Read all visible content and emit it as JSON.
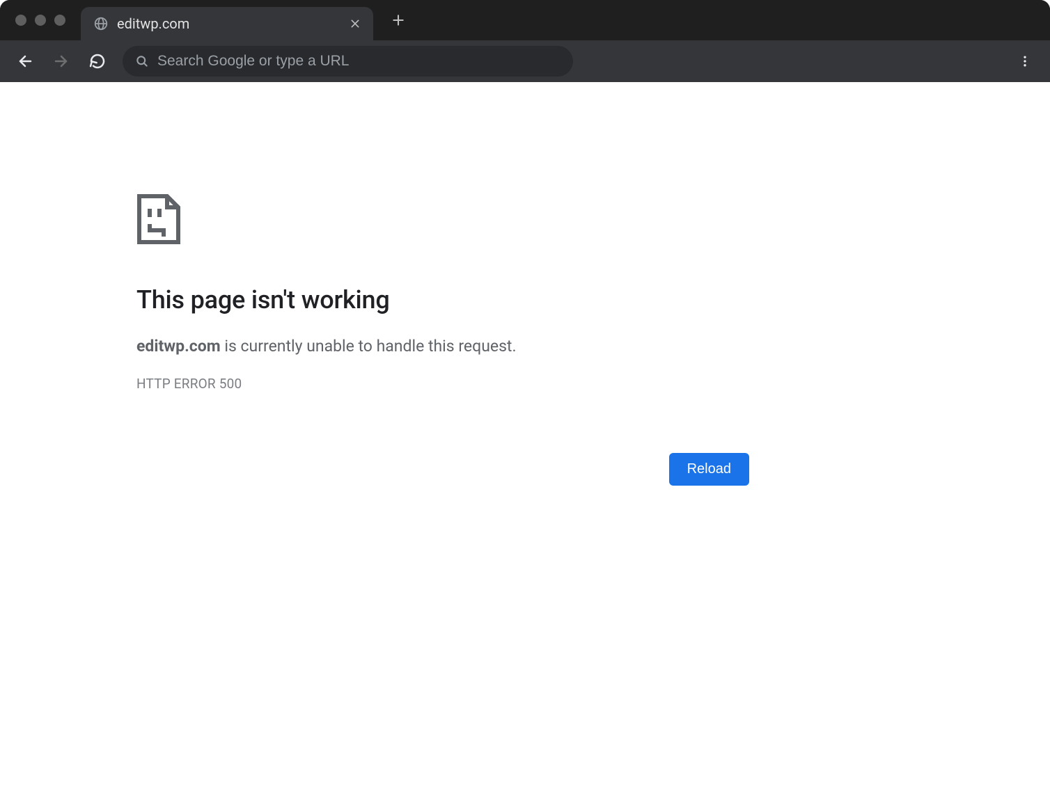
{
  "browser": {
    "tab_title": "editwp.com",
    "omnibox_placeholder": "Search Google or type a URL"
  },
  "error_page": {
    "title": "This page isn't working",
    "domain": "editwp.com",
    "message_tail": " is currently unable to handle this request.",
    "error_code": "HTTP ERROR 500",
    "reload_label": "Reload"
  }
}
